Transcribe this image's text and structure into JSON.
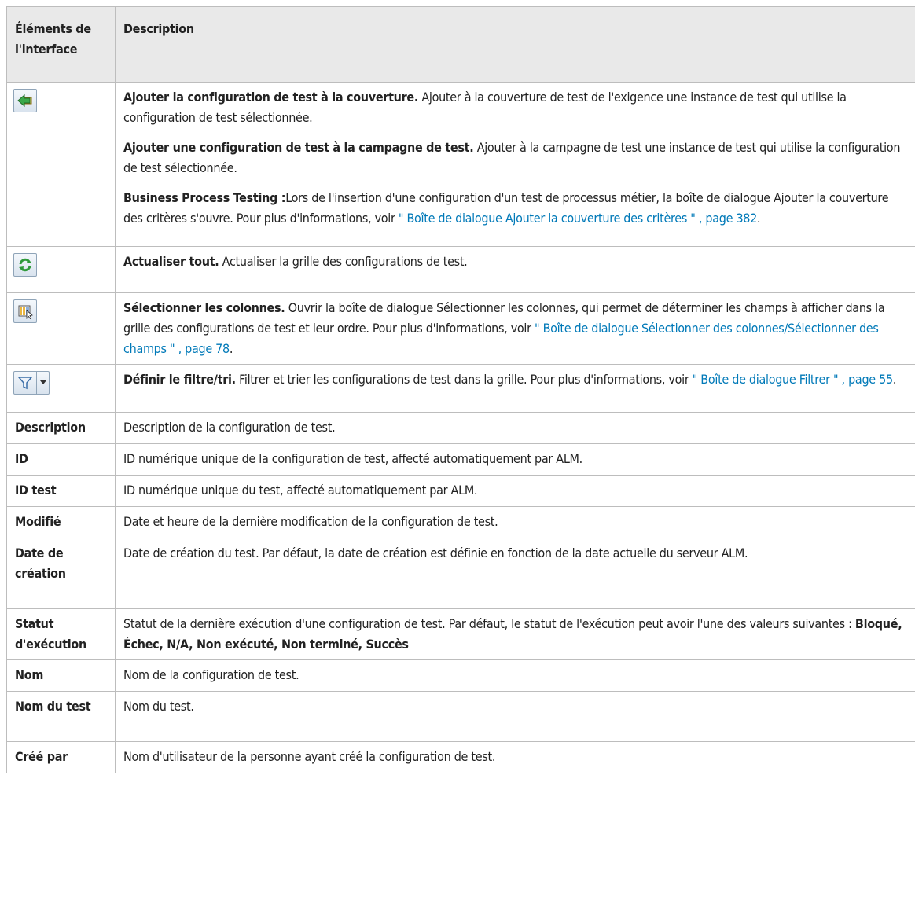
{
  "header": {
    "col1": "Éléments de l'interface",
    "col2": "Description"
  },
  "rows": {
    "add_config": {
      "icon": "add-to-coverage-icon",
      "p1_bold": "Ajouter la configuration de test à la couverture.",
      "p1_text": " Ajouter à la couverture de test de l'exigence une instance de test qui utilise la configuration de test sélectionnée.",
      "p2_bold": "Ajouter une configuration de test à la campagne de test.",
      "p2_text": " Ajouter à la campagne de test une instance de test qui utilise la configuration de test sélectionnée.",
      "p3_bold": "Business Process Testing :",
      "p3_text": "Lors de l'insertion d'une configuration d'un test de processus métier, la boîte de dialogue Ajouter la couverture des critères s'ouvre. Pour plus d'informations, voir ",
      "p3_link": "\" Boîte de dialogue Ajouter la couverture des critères \" , page 382",
      "p3_end": "."
    },
    "refresh": {
      "icon": "refresh-icon",
      "bold": "Actualiser tout.",
      "text": " Actualiser la grille des configurations de test."
    },
    "select_columns": {
      "icon": "select-columns-icon",
      "bold": "Sélectionner les colonnes.",
      "text": " Ouvrir la boîte de dialogue Sélectionner les colonnes, qui permet de déterminer les champs à afficher dans la grille des configurations de test et leur ordre. Pour plus d'informations, voir ",
      "link": "\" Boîte de dialogue Sélectionner des colonnes/Sélectionner des champs \" , page 78",
      "end": "."
    },
    "filter": {
      "icon": "filter-icon",
      "dropdown_icon": "dropdown-arrow-icon",
      "bold": "Définir le filtre/tri.",
      "text": " Filtrer et trier les configurations de test dans la grille. Pour plus d'informations, voir ",
      "link": "\" Boîte de dialogue Filtrer \" , page 55",
      "end": "."
    },
    "description": {
      "label": "Description",
      "text": "Description de la configuration de test."
    },
    "id": {
      "label": "ID",
      "text": "ID numérique unique de la configuration de test, affecté automatiquement par ALM."
    },
    "test_id": {
      "label": "ID test",
      "text": "ID numérique unique du test, affecté automatiquement par ALM."
    },
    "modified": {
      "label": "Modifié",
      "text": "Date et heure de la dernière modification de la configuration de test."
    },
    "creation_date": {
      "label": "Date de création",
      "text": "Date de création du test. Par défaut, la date de création est définie en fonction de la date actuelle du serveur ALM."
    },
    "exec_status": {
      "label": "Statut d'exécution",
      "text": "Statut de la dernière exécution d'une configuration de test. Par défaut, le statut de l'exécution peut avoir l'une des valeurs suivantes : ",
      "values": "Bloqué, Échec, N/A, Non exécuté, Non terminé, Succès"
    },
    "name": {
      "label": "Nom",
      "text": "Nom de la configuration de test."
    },
    "test_name": {
      "label": "Nom du test",
      "text": "Nom du test."
    },
    "created_by": {
      "label": "Créé par",
      "text": "Nom d'utilisateur de la personne ayant créé la configuration de test."
    }
  }
}
